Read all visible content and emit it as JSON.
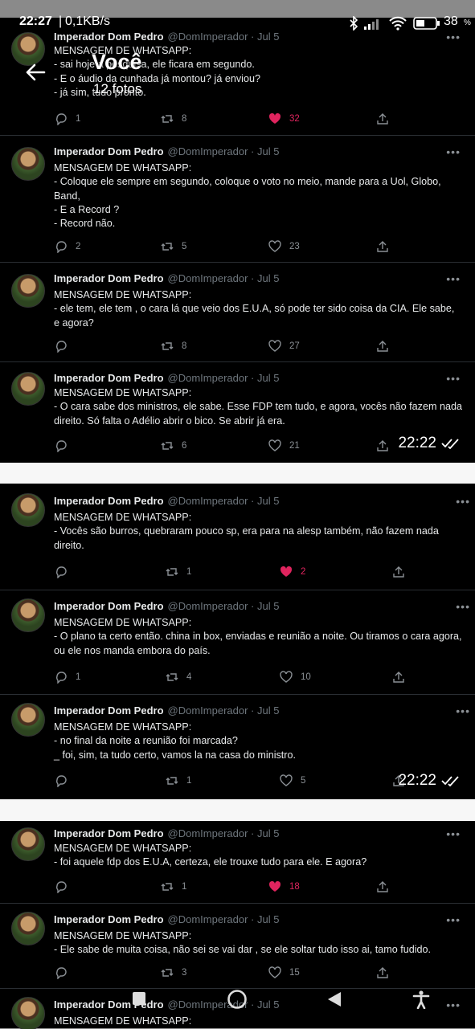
{
  "status_bar": {
    "time": "22:27",
    "speed": "0,1KB/s",
    "battery": "38",
    "battery_unit": "%"
  },
  "gallery": {
    "title": "Você",
    "subtitle": "12 fotos"
  },
  "tweets": [
    {
      "name": "Imperador Dom Pedro",
      "handle": "@DomImperador",
      "date": "Jul 5",
      "lines": [
        "MENSAGEM DE WHATSAPP:",
        "- sai hoje a pesquisa, ele ficara em segundo.",
        "- E o áudio da cunhada já montou? já enviou?",
        "- já sim, tudo pronto."
      ],
      "replies": "1",
      "retweets": "8",
      "likes": "32",
      "liked": true
    },
    {
      "name": "Imperador Dom Pedro",
      "handle": "@DomImperador",
      "date": "Jul 5",
      "lines": [
        "MENSAGEM DE WHATSAPP:",
        "- Coloque ele sempre em segundo, coloque o voto no meio, mande para a Uol, Globo, Band,",
        "- E a Record ?",
        "- Record não."
      ],
      "replies": "2",
      "retweets": "5",
      "likes": "23",
      "liked": false
    },
    {
      "name": "Imperador Dom Pedro",
      "handle": "@DomImperador",
      "date": "Jul 5",
      "lines": [
        "MENSAGEM DE WHATSAPP:",
        "- ele tem, ele tem , o cara lá que veio dos E.U.A, só pode ter sido coisa da CIA. Ele sabe, e agora?"
      ],
      "replies": "",
      "retweets": "8",
      "likes": "27",
      "liked": false
    },
    {
      "name": "Imperador Dom Pedro",
      "handle": "@DomImperador",
      "date": "Jul 5",
      "lines": [
        "MENSAGEM DE WHATSAPP:",
        "- O cara sabe dos ministros, ele sabe. Esse FDP tem tudo, e agora, vocês não fazem nada direito. Só falta o Adélio abrir o bico. Se abrir já era."
      ],
      "replies": "",
      "retweets": "6",
      "likes": "21",
      "liked": false
    },
    {
      "name": "Imperador Dom Pedro",
      "handle": "@DomImperador",
      "date": "Jul 5",
      "lines": [
        "MENSAGEM DE WHATSAPP:",
        "- Vocês são burros, quebraram pouco sp, era para na alesp também, não fazem nada direito."
      ],
      "replies": "",
      "retweets": "1",
      "likes": "2",
      "liked": true
    },
    {
      "name": "Imperador Dom Pedro",
      "handle": "@DomImperador",
      "date": "Jul 5",
      "lines": [
        "MENSAGEM DE WHATSAPP:",
        "- O plano ta certo então. china in box, enviadas e reunião a noite. Ou tiramos o cara agora, ou ele nos manda embora do país."
      ],
      "replies": "1",
      "retweets": "4",
      "likes": "10",
      "liked": false
    },
    {
      "name": "Imperador Dom Pedro",
      "handle": "@DomImperador",
      "date": "Jul 5",
      "lines": [
        "MENSAGEM DE WHATSAPP:",
        "- no final da noite a reunião foi marcada?",
        "_ foi, sim, ta tudo certo, vamos la na casa do ministro."
      ],
      "replies": "",
      "retweets": "1",
      "likes": "5",
      "liked": false
    },
    {
      "name": "Imperador Dom Pedro",
      "handle": "@DomImperador",
      "date": "Jul 5",
      "lines": [
        "MENSAGEM DE WHATSAPP:",
        "- foi aquele fdp dos E.U.A, certeza, ele trouxe tudo para ele. E agora?"
      ],
      "replies": "",
      "retweets": "1",
      "likes": "18",
      "liked": true
    },
    {
      "name": "Imperador Dom Pedro",
      "handle": "@DomImperador",
      "date": "Jul 5",
      "lines": [
        "MENSAGEM DE WHATSAPP:",
        "- Ele sabe de muita coisa, não sei se vai dar , se ele soltar tudo isso ai, tamo fudido."
      ],
      "replies": "",
      "retweets": "3",
      "likes": "15",
      "liked": false
    },
    {
      "name": "Imperador Dom Pedro",
      "handle": "@DomImperador",
      "date": "Jul 5",
      "lines": [
        "MENSAGEM DE WHATSAPP:"
      ],
      "replies": "",
      "retweets": "",
      "likes": "",
      "liked": false
    }
  ],
  "timestamps": [
    "22:22",
    "22:22"
  ],
  "colors": {
    "background": "#000000",
    "text": "#e7e9ea",
    "muted": "#6e767d",
    "like": "#e0245e"
  },
  "icons": [
    "back-arrow-icon",
    "bluetooth-icon",
    "signal-icon",
    "wifi-icon",
    "battery-icon",
    "reply-icon",
    "retweet-icon",
    "heart-icon",
    "share-icon",
    "double-check-icon",
    "nav-square-icon",
    "nav-circle-icon",
    "nav-back-icon",
    "accessibility-icon"
  ]
}
